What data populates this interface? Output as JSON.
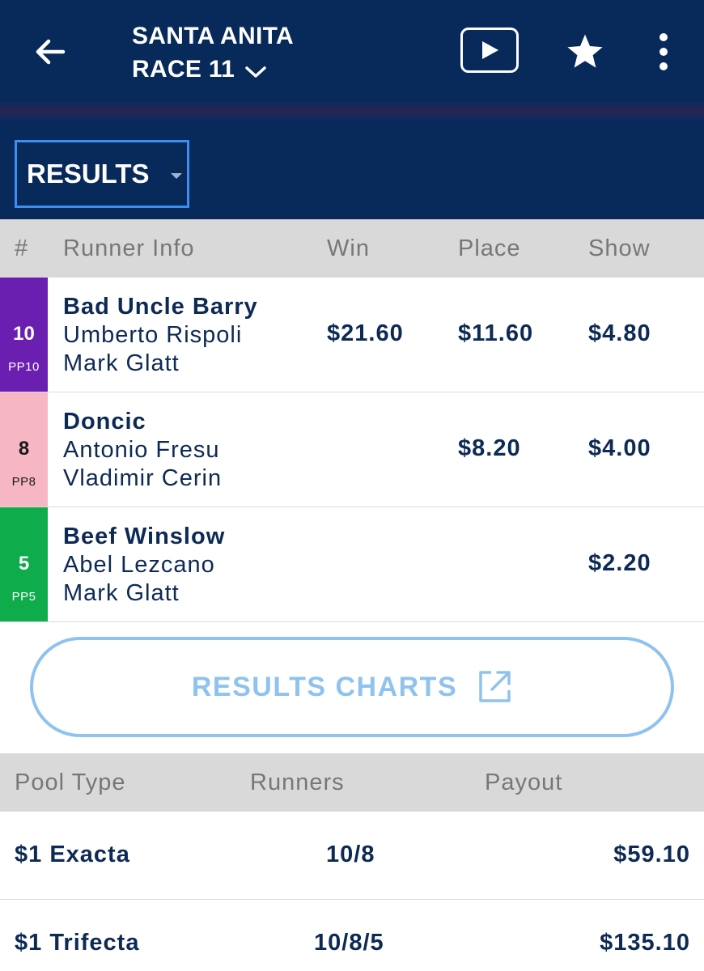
{
  "header": {
    "track": "SANTA ANITA",
    "race": "RACE 11",
    "icons": {
      "back": "back-arrow-icon",
      "race_dropdown": "chevron-down-icon",
      "video": "play-icon",
      "favorite": "star-icon",
      "more": "more-vertical-icon"
    }
  },
  "view_select": {
    "selected": "RESULTS",
    "icon": "caret-down-icon"
  },
  "results_table": {
    "headers": {
      "pp": "#",
      "runner": "Runner Info",
      "win": "Win",
      "place": "Place",
      "show": "Show"
    },
    "rows": [
      {
        "number": "10",
        "pp_label": "PP10",
        "color": "#6a1fb0",
        "number_color": "#ffffff",
        "horse": "Bad Uncle Barry",
        "jockey": "Umberto Rispoli",
        "trainer": "Mark Glatt",
        "win": "$21.60",
        "place": "$11.60",
        "show": "$4.80"
      },
      {
        "number": "8",
        "pp_label": "PP8",
        "color": "#f7b6c4",
        "number_color": "#1a1a1a",
        "horse": "Doncic",
        "jockey": "Antonio Fresu",
        "trainer": "Vladimir Cerin",
        "win": "",
        "place": "$8.20",
        "show": "$4.00"
      },
      {
        "number": "5",
        "pp_label": "PP5",
        "color": "#0eac4a",
        "number_color": "#ffffff",
        "horse": "Beef Winslow",
        "jockey": "Abel Lezcano",
        "trainer": "Mark Glatt",
        "win": "",
        "place": "",
        "show": "$2.20"
      }
    ]
  },
  "results_charts_button": {
    "label": "RESULTS CHARTS",
    "icon": "external-link-icon"
  },
  "pools_table": {
    "headers": {
      "pool_type": "Pool Type",
      "runners": "Runners",
      "payout": "Payout"
    },
    "rows": [
      {
        "pool_type": "$1 Exacta",
        "runners": "10/8",
        "payout": "$59.10"
      },
      {
        "pool_type": "$1 Trifecta",
        "runners": "10/8/5",
        "payout": "$135.10"
      }
    ]
  }
}
